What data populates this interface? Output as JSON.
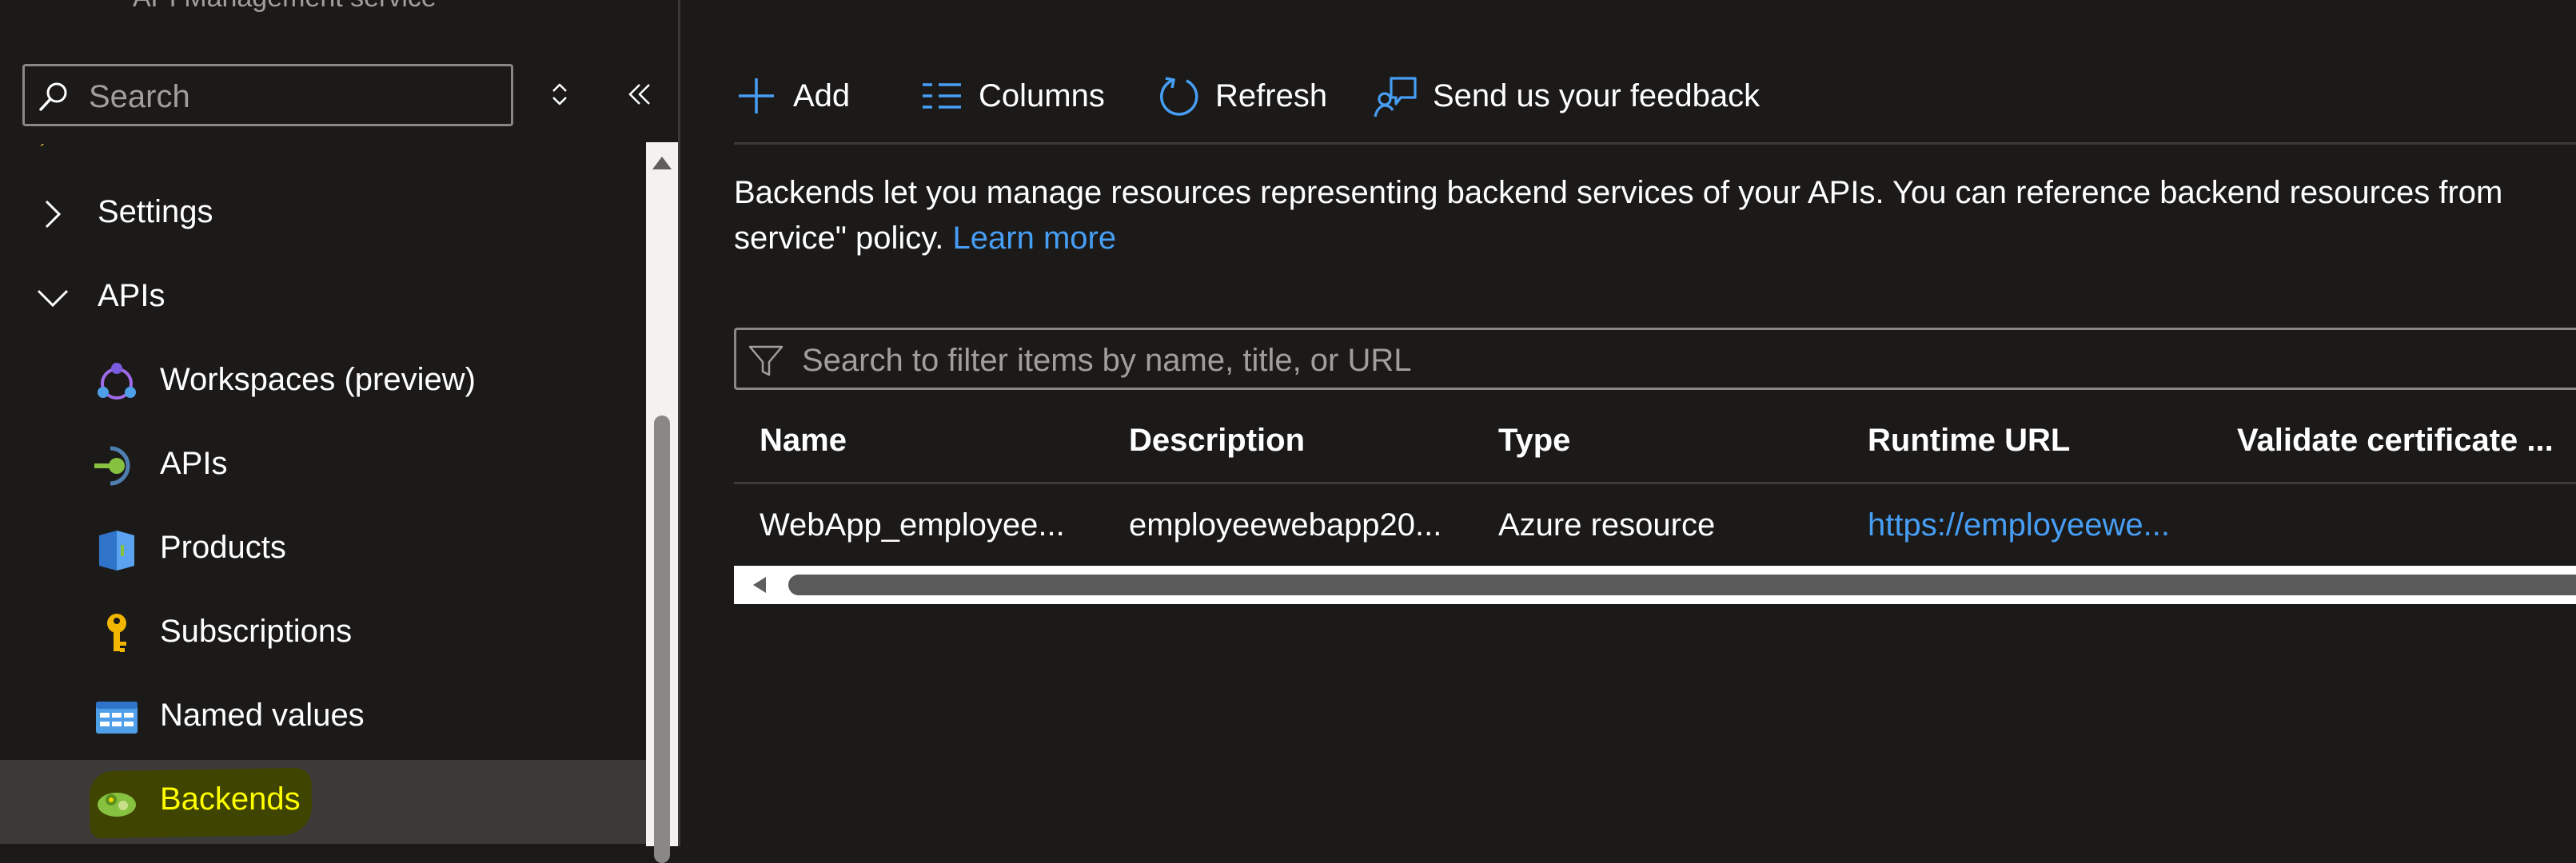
{
  "header": {
    "service_subtitle": "API Management service"
  },
  "nav": {
    "search_placeholder": "Search",
    "items": [
      {
        "label": "Settings",
        "kind": "group",
        "expanded": false
      },
      {
        "label": "APIs",
        "kind": "group",
        "expanded": true
      },
      {
        "label": "Workspaces (preview)",
        "icon": "workspaces-icon"
      },
      {
        "label": "APIs",
        "icon": "apis-icon"
      },
      {
        "label": "Products",
        "icon": "products-icon"
      },
      {
        "label": "Subscriptions",
        "icon": "key-icon"
      },
      {
        "label": "Named values",
        "icon": "named-values-icon"
      },
      {
        "label": "Backends",
        "icon": "backends-icon",
        "selected": true
      }
    ]
  },
  "commandbar": {
    "add": "Add",
    "columns": "Columns",
    "refresh": "Refresh",
    "feedback": "Send us your feedback"
  },
  "description": {
    "line1": "Backends let you manage resources representing backend services of your APIs. You can reference backend resources from",
    "line2": "service\" policy.",
    "learn_more": "Learn more"
  },
  "filter": {
    "placeholder": "Search to filter items by name, title, or URL"
  },
  "grid": {
    "columns": [
      "Name",
      "Description",
      "Type",
      "Runtime URL",
      "Validate certificate ..."
    ],
    "rows": [
      {
        "name": "WebApp_employee...",
        "description": "employeewebapp20...",
        "type": "Azure resource",
        "runtime_url": "https://employeewe...",
        "validate_certificate": ""
      }
    ]
  },
  "colors": {
    "background": "#1b1a19",
    "accent": "#479ef5",
    "selected_bg": "#3b3a39",
    "highlight_text": "#ffff00"
  }
}
